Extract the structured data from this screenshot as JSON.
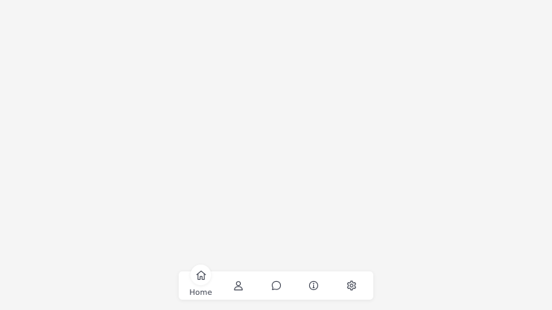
{
  "nav": {
    "active_index": 0,
    "items": [
      {
        "id": "home",
        "label": "Home",
        "icon": "home-icon"
      },
      {
        "id": "profile",
        "label": "",
        "icon": "user-icon"
      },
      {
        "id": "messages",
        "label": "",
        "icon": "chat-bubble-icon"
      },
      {
        "id": "info",
        "label": "",
        "icon": "info-icon"
      },
      {
        "id": "settings",
        "label": "",
        "icon": "gear-icon"
      }
    ]
  },
  "colors": {
    "background": "#f5f5f5",
    "bar": "#ffffff",
    "icon": "#3a3f4d"
  }
}
